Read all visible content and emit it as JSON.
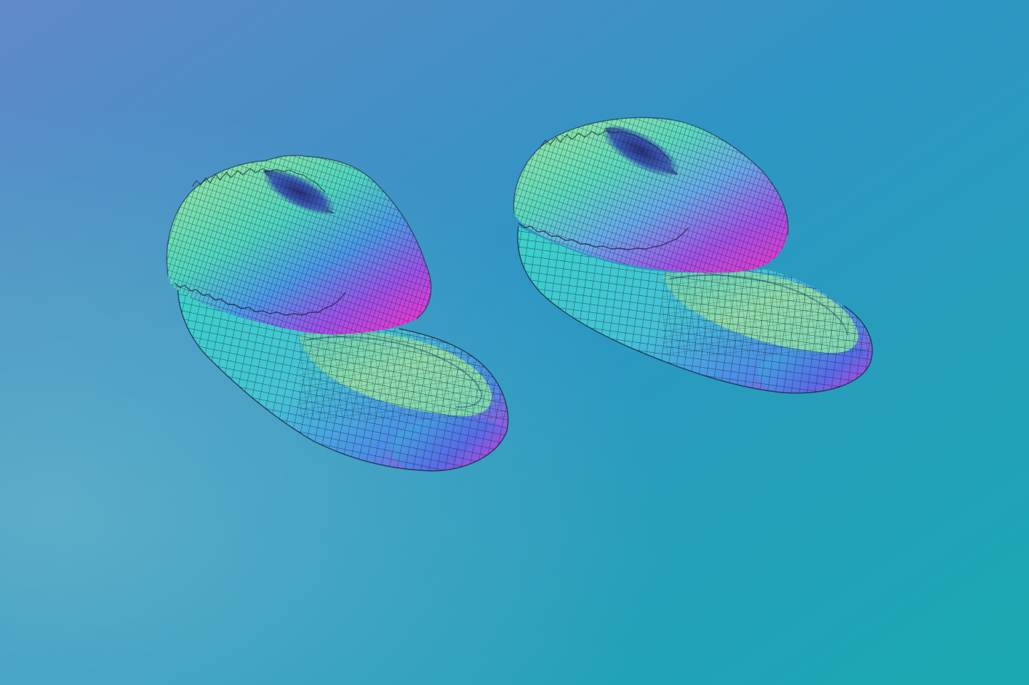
{
  "scene": {
    "subject": "pair-of-slippers",
    "render_style": "normal-map-wireframe",
    "wireframe": true,
    "colors": {
      "background_top_left": "#5b8ec9",
      "background_top_right": "#1a93bd",
      "background_bottom_left": "#5aa9c4",
      "background_bottom_right": "#1aa9b1",
      "mesh_green": "#7fe0a8",
      "mesh_cyan": "#3fd4c8",
      "mesh_blue": "#3a7fe0",
      "mesh_magenta": "#d83ad8",
      "mesh_violet": "#8a4fe6",
      "wire": "#1a1a2e"
    }
  }
}
